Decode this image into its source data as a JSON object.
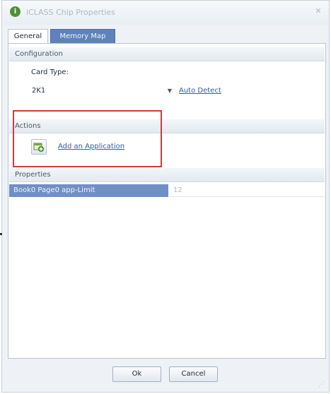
{
  "window": {
    "title": "iCLASS Chip Properties",
    "app_icon": "app-logo-icon",
    "close_icon": "close-icon",
    "close_glyph": "✕"
  },
  "tabs": [
    {
      "label": "General",
      "selected": false
    },
    {
      "label": "Memory Map",
      "selected": true
    }
  ],
  "configuration": {
    "header": "Configuration",
    "card_type_label": "Card Type:",
    "card_type_value": "2K1",
    "auto_detect_label": "Auto Detect"
  },
  "actions": {
    "header": "Actions",
    "add_application_label": "Add an Application",
    "add_application_icon": "add-application-icon"
  },
  "properties": {
    "header": "Properties",
    "rows": [
      {
        "name": "Book0 Page0 app-Limit",
        "value": "12"
      }
    ]
  },
  "buttons": {
    "ok_label": "Ok",
    "cancel_label": "Cancel"
  },
  "colors": {
    "selected_tab": "#5e82b9",
    "selected_row": "#6f8fc5",
    "highlight": "#d23a3a",
    "link": "#2c5bb5"
  }
}
